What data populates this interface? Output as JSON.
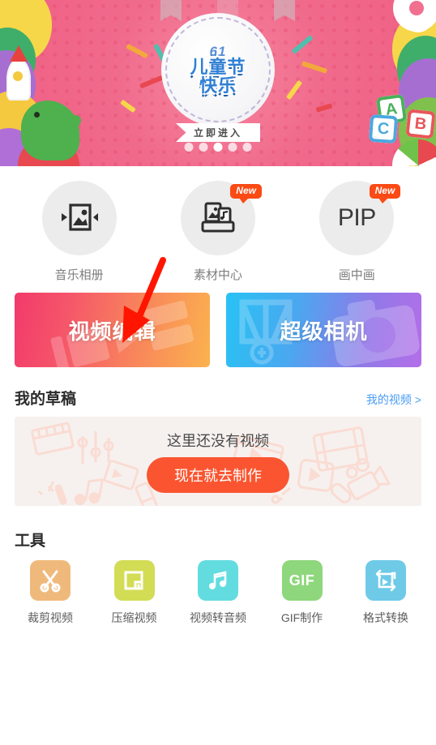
{
  "banner": {
    "badge_number": "61",
    "headline_line1": "儿童节",
    "headline_line2": "快乐",
    "cta": "立即进入"
  },
  "features": [
    {
      "label": "音乐相册",
      "icon": "photo-frame-carousel-icon",
      "badge": null
    },
    {
      "label": "素材中心",
      "icon": "material-center-icon",
      "badge": "New"
    },
    {
      "label": "画中画",
      "icon": "pip-text-icon",
      "badge": "New",
      "text": "PIP"
    }
  ],
  "primary_actions": [
    {
      "label": "视频编辑",
      "gradient_from": "#F23A6B",
      "gradient_to": "#FBB24E"
    },
    {
      "label": "超级相机",
      "gradient_from": "#28C2F4",
      "gradient_to": "#B46EE8"
    }
  ],
  "drafts": {
    "title": "我的草稿",
    "link": "我的视频 >",
    "empty_text": "这里还没有视频",
    "cta": "现在就去制作",
    "cta_color": "#FA5530",
    "link_color": "#4A9CF5"
  },
  "tools": {
    "title": "工具",
    "items": [
      {
        "label": "裁剪视频",
        "icon": "scissors-icon",
        "color": "#F0B97C"
      },
      {
        "label": "压缩视频",
        "icon": "compress-frame-icon",
        "color": "#D3DC55"
      },
      {
        "label": "视频转音频",
        "icon": "music-notes-icon",
        "color": "#63DCE0"
      },
      {
        "label": "GIF制作",
        "icon": "gif-text-icon",
        "color": "#8ED77C",
        "text": "GIF"
      },
      {
        "label": "格式转换",
        "icon": "format-convert-icon",
        "color": "#6FCAE8"
      }
    ]
  },
  "annotation": {
    "type": "red-arrow",
    "points_to": "视频编辑",
    "color": "#FF1500"
  }
}
